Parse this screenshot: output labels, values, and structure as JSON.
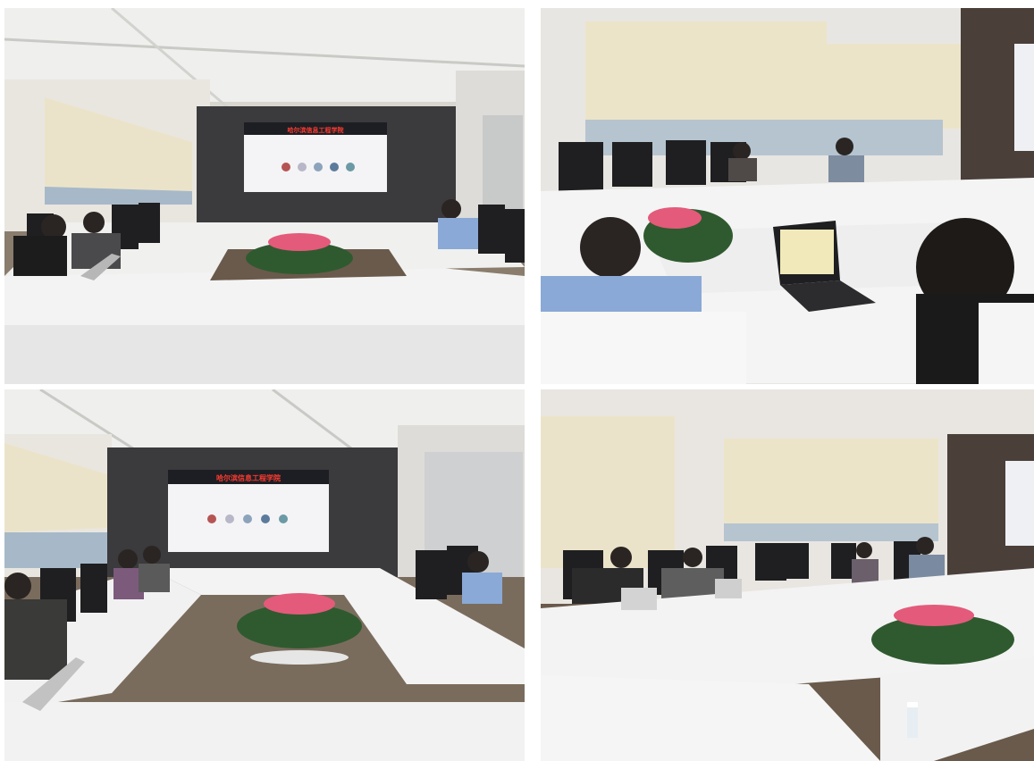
{
  "photos": [
    {
      "screen_banner": "哈尔滨信息工程学院"
    },
    {
      "screen_banner": ""
    },
    {
      "screen_banner": "哈尔滨信息工程学院"
    },
    {
      "screen_banner": ""
    }
  ],
  "colors": {
    "wall": "#e9e6e0",
    "ceiling": "#efefed",
    "blinds": "#ebe3c9",
    "dark_wall": "#3b3a3c",
    "table": "#f3f3f3",
    "floor": "#6a5a4b",
    "chair": "#1f1f21",
    "flower": "#e45a7a",
    "leaf": "#2f5a2f",
    "shirt_blue": "#8aa9d6"
  },
  "icons": [
    "screen-icon",
    "flower-bouquet-icon",
    "chair-icon",
    "laptop-icon"
  ]
}
